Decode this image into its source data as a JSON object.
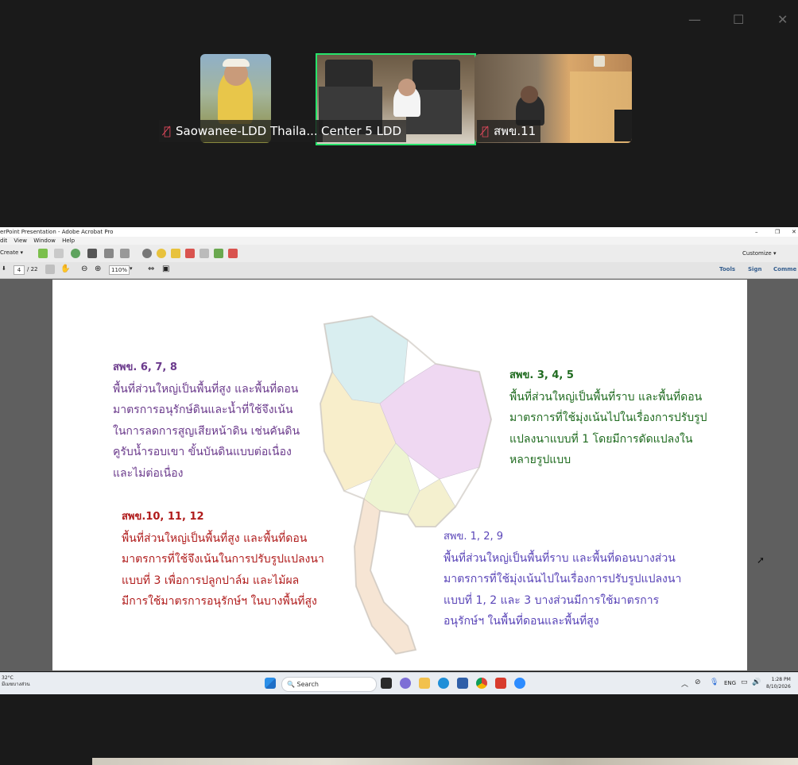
{
  "meeting": {
    "participants": [
      {
        "name": "Saowanee-LDD Thaila...",
        "muted": true
      },
      {
        "name": "Center 5 LDD",
        "muted": false,
        "active_speaker": true
      },
      {
        "name": "สพข.11",
        "muted": true
      }
    ],
    "window_controls": {
      "minimize": "—",
      "maximize": "☐",
      "close": "✕"
    }
  },
  "acrobat": {
    "title": "erPoint Presentation - Adobe Acrobat Pro",
    "menu": [
      "dit",
      "View",
      "Window",
      "Help"
    ],
    "create_label": "Create ▾",
    "customize_label": "Customize ▾",
    "page_current": "4",
    "page_total": "/ 22",
    "zoom": "110%",
    "right_tabs": [
      "Tools",
      "Sign",
      "Comme"
    ]
  },
  "slide": {
    "block_nw": {
      "header": "สพข. 6, 7, 8",
      "lines": [
        "พื้นที่ส่วนใหญ่เป็นพื้นที่สูง และพื้นที่ดอน",
        "มาตรการอนุรักษ์ดินและน้ำที่ใช้จึงเน้น",
        "ในการลดการสูญเสียหน้าดิน เช่นคันดิน",
        "คูรับน้ำรอบเขา ขั้นบันดินแบบต่อเนื่อง",
        "และไม่ต่อเนื่อง"
      ]
    },
    "block_ne": {
      "header": "สพข. 3, 4, 5",
      "lines": [
        "พื้นที่ส่วนใหญ่เป็นพื้นที่ราบ และพื้นที่ดอน",
        "มาตรการที่ใช้มุ่งเน้นไปในเรื่องการปรับรูป",
        "แปลงนาแบบที่ 1 โดยมีการดัดแปลงใน",
        "หลายรูปแบบ"
      ]
    },
    "block_sw": {
      "header": "สพข.10, 11, 12",
      "lines": [
        "พื้นที่ส่วนใหญ่เป็นพื้นที่สูง และพื้นที่ดอน",
        "มาตรการที่ใช้จึงเน้นในการปรับรูปแปลงนา",
        "แบบที่ 3 เพื่อการปลูกปาล์ม และไม้ผล",
        "มีการใช้มาตรการอนุรักษ์ฯ ในบางพื้นที่สูง"
      ]
    },
    "block_se": {
      "header": "สพข. 1, 2, 9",
      "lines": [
        "พื้นที่ส่วนใหญ่เป็นพื้นที่ราบ และพื้นที่ดอนบางส่วน",
        "มาตรการที่ใช้มุ่งเน้นไปในเรื่องการปรับรูปแปลงนา",
        "แบบที่ 1, 2 และ 3 บางส่วนมีการใช้มาตรการ",
        "อนุรักษ์ฯ ในพื้นที่ดอนและพื้นที่สูง"
      ]
    },
    "colors": {
      "nw": "#6b3a8c",
      "ne": "#1f6b1f",
      "sw": "#b01c1c",
      "se": "#5a45b8"
    }
  },
  "taskbar": {
    "weather_temp": "32°C",
    "weather_desc": "มีเมฆบางส่วน",
    "search_placeholder": "Search",
    "lang": "ENG",
    "time": "1:28 PM",
    "date": "8/10/2026"
  }
}
